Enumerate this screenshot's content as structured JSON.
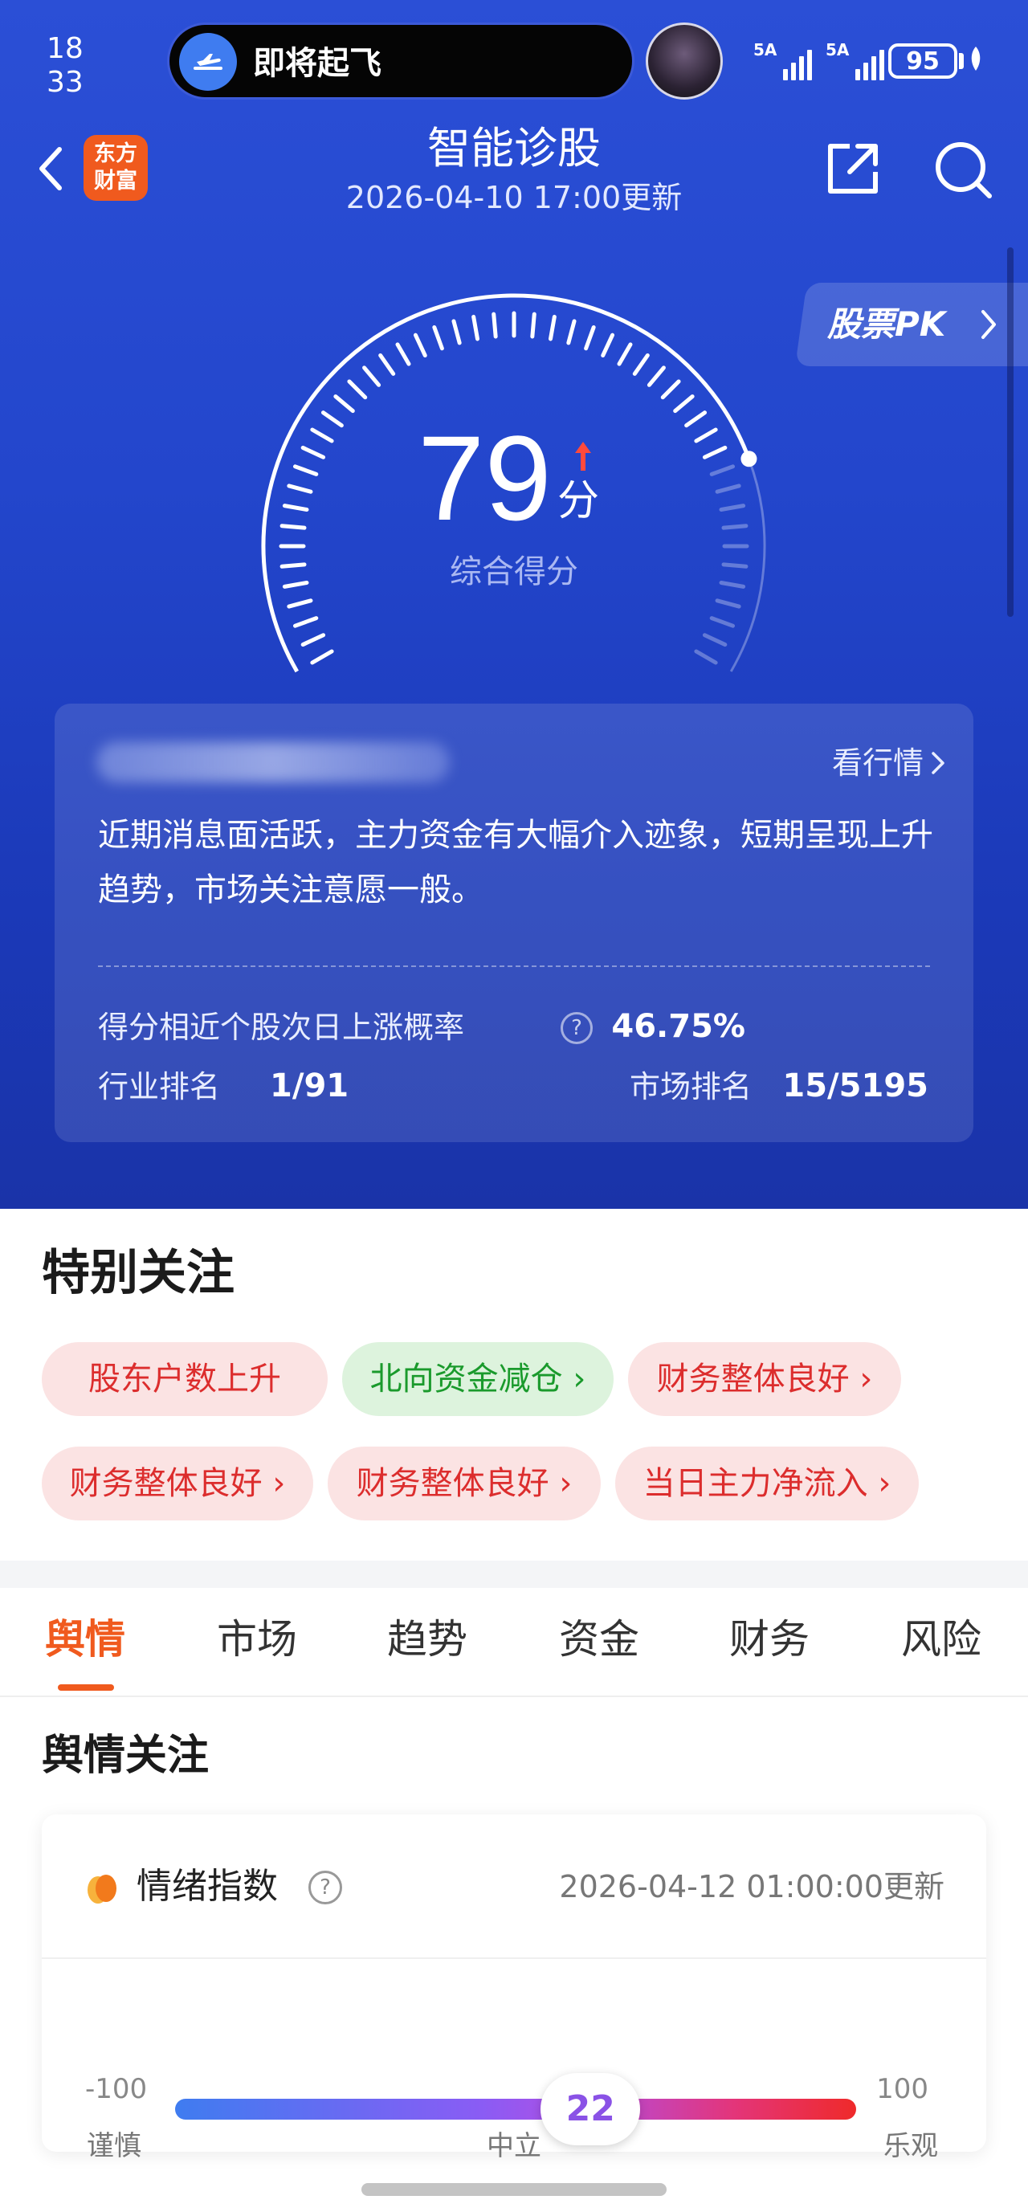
{
  "status_bar": {
    "time_hour": "18",
    "time_min": "33",
    "island_text": "即将起飞",
    "signal1_label": "5A",
    "signal2_label": "5A",
    "battery": "95"
  },
  "nav": {
    "title": "智能诊股",
    "subtitle": "2026-04-10 17:00更新",
    "brand_line1": "东方",
    "brand_line2": "财富",
    "pk_label": "股票PK"
  },
  "score": {
    "value": "79",
    "unit": "分",
    "label": "综合得分",
    "fraction": 0.79,
    "trend": "up"
  },
  "summary": {
    "market_link": "看行情",
    "text": "近期消息面活跃，主力资金有大幅介入迹象，短期呈现上升趋势，市场关注意愿一般。",
    "prob_label": "得分相近个股次日上涨概率",
    "prob_value": "46.75%",
    "industry_label": "行业排名",
    "industry_value": "1/91",
    "market_label": "市场排名",
    "market_value": "15/5195"
  },
  "special": {
    "title": "特别关注",
    "chips": [
      {
        "label": "股东户数上升",
        "color": "red",
        "arrow": false
      },
      {
        "label": "北向资金减仓 ›",
        "color": "green",
        "arrow": true
      },
      {
        "label": "财务整体良好 ›",
        "color": "red",
        "arrow": true
      },
      {
        "label": "财务整体良好 ›",
        "color": "red",
        "arrow": true
      },
      {
        "label": "财务整体良好 ›",
        "color": "red",
        "arrow": true
      },
      {
        "label": "当日主力净流入 ›",
        "color": "red",
        "arrow": true
      }
    ]
  },
  "tabs": [
    "舆情",
    "市场",
    "趋势",
    "资金",
    "财务",
    "风险"
  ],
  "sentiment": {
    "title": "舆情关注",
    "card_title": "情绪指数",
    "updated": "2026-04-12 01:00:00更新",
    "min": "-100",
    "max": "100",
    "value": "22",
    "value_num": 22,
    "label_left": "谨慎",
    "label_mid": "中立",
    "label_right": "乐观"
  },
  "colors": {
    "accent": "#f05a1e",
    "hero_blue": "#2346cc",
    "chip_red_text": "#dc2d2d",
    "chip_green_text": "#1a9a2c"
  },
  "icons": [
    "airplane-takeoff-icon",
    "back-icon",
    "share-icon",
    "search-icon",
    "chevron-right-icon",
    "help-icon",
    "mood-icon"
  ]
}
